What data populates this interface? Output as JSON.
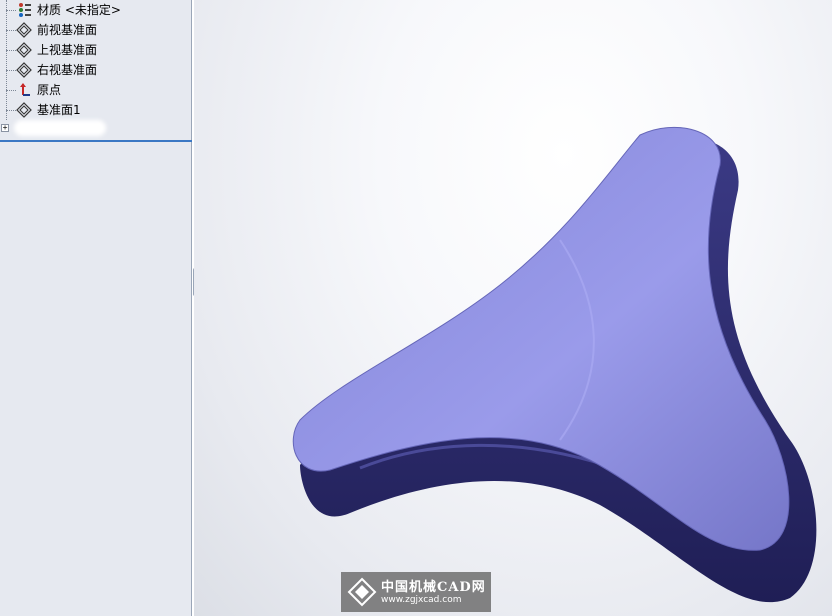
{
  "feature_tree": {
    "items": [
      {
        "label": "材质 <未指定>",
        "icon": "material-icon"
      },
      {
        "label": "前视基准面",
        "icon": "plane-icon"
      },
      {
        "label": "上视基准面",
        "icon": "plane-icon"
      },
      {
        "label": "右视基准面",
        "icon": "plane-icon"
      },
      {
        "label": "原点",
        "icon": "origin-icon"
      },
      {
        "label": "基准面1",
        "icon": "plane-icon"
      }
    ],
    "expander_symbol": "+"
  },
  "splitter": {
    "grip": "‹‹‹"
  },
  "model": {
    "top_face_color": "#8e8fe0",
    "side_color": "#2e2d6b"
  },
  "watermark": {
    "title": "中国机械CAD网",
    "url": "www.zgjxcad.com"
  }
}
